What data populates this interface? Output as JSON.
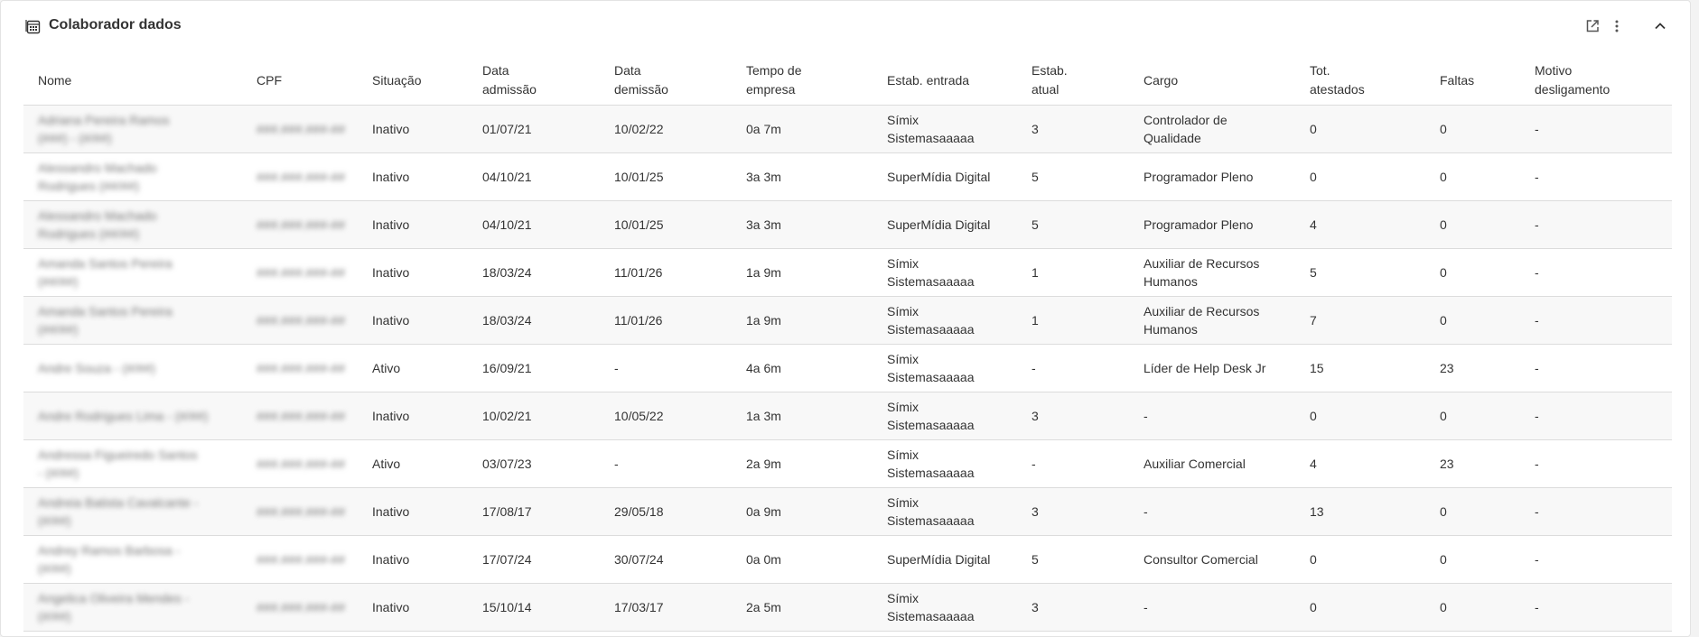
{
  "title": "Colaborador dados",
  "icons": {
    "title": "calculator-icon",
    "open": "open-external-icon",
    "more": "more-vertical-icon",
    "collapse": "chevron-up-icon"
  },
  "columns": [
    "Nome",
    "CPF",
    "Situação",
    "Data admissão",
    "Data demissão",
    "Tempo de empresa",
    "Estab. entrada",
    "Estab. atual",
    "Cargo",
    "Tot. atestados",
    "Faltas",
    "Motivo desligamento"
  ],
  "header_lines": [
    [
      "Nome"
    ],
    [
      "CPF"
    ],
    [
      "Situação"
    ],
    [
      "Data",
      "admissão"
    ],
    [
      "Data",
      "demissão"
    ],
    [
      "Tempo de",
      "empresa"
    ],
    [
      "Estab. entrada"
    ],
    [
      "Estab.",
      "atual"
    ],
    [
      "Cargo"
    ],
    [
      "Tot.",
      "atestados"
    ],
    [
      "Faltas"
    ],
    [
      "Motivo",
      "desligamento"
    ]
  ],
  "rows": [
    {
      "nome": [
        "Adriana Pereira Ramos",
        "(###) - (#/##)"
      ],
      "cpf": "###.###.###-##",
      "situacao": "Inativo",
      "admissao": "01/07/21",
      "demissao": "10/02/22",
      "tempo": "0a 7m",
      "estab_entrada": [
        "Símix",
        "Sistemasaaaaa"
      ],
      "estab_atual": "3",
      "cargo": [
        "Controlador de",
        "Qualidade"
      ],
      "atestados": "0",
      "faltas": "0",
      "motivo": "-"
    },
    {
      "nome": [
        "Alessandro Machado",
        "Rodrigues (##/##)"
      ],
      "cpf": "###.###.###-##",
      "situacao": "Inativo",
      "admissao": "04/10/21",
      "demissao": "10/01/25",
      "tempo": "3a 3m",
      "estab_entrada": [
        "SuperMídia Digital"
      ],
      "estab_atual": "5",
      "cargo": [
        "Programador Pleno"
      ],
      "atestados": "0",
      "faltas": "0",
      "motivo": "-"
    },
    {
      "nome": [
        "Alessandro Machado",
        "Rodrigues (##/##)"
      ],
      "cpf": "###.###.###-##",
      "situacao": "Inativo",
      "admissao": "04/10/21",
      "demissao": "10/01/25",
      "tempo": "3a 3m",
      "estab_entrada": [
        "SuperMídia Digital"
      ],
      "estab_atual": "5",
      "cargo": [
        "Programador Pleno"
      ],
      "atestados": "4",
      "faltas": "0",
      "motivo": "-"
    },
    {
      "nome": [
        "Amanda Santos Pereira",
        "(##/##)"
      ],
      "cpf": "###.###.###-##",
      "situacao": "Inativo",
      "admissao": "18/03/24",
      "demissao": "11/01/26",
      "tempo": "1a 9m",
      "estab_entrada": [
        "Símix",
        "Sistemasaaaaa"
      ],
      "estab_atual": "1",
      "cargo": [
        "Auxiliar de Recursos",
        "Humanos"
      ],
      "atestados": "5",
      "faltas": "0",
      "motivo": "-"
    },
    {
      "nome": [
        "Amanda Santos Pereira",
        "(##/##)"
      ],
      "cpf": "###.###.###-##",
      "situacao": "Inativo",
      "admissao": "18/03/24",
      "demissao": "11/01/26",
      "tempo": "1a 9m",
      "estab_entrada": [
        "Símix",
        "Sistemasaaaaa"
      ],
      "estab_atual": "1",
      "cargo": [
        "Auxiliar de Recursos",
        "Humanos"
      ],
      "atestados": "7",
      "faltas": "0",
      "motivo": "-"
    },
    {
      "nome": [
        "Andre Souza - (#/##)"
      ],
      "cpf": "###.###.###-##",
      "situacao": "Ativo",
      "admissao": "16/09/21",
      "demissao": "-",
      "tempo": "4a 6m",
      "estab_entrada": [
        "Símix",
        "Sistemasaaaaa"
      ],
      "estab_atual": "-",
      "cargo": [
        "Líder de Help Desk Jr"
      ],
      "atestados": "15",
      "faltas": "23",
      "motivo": "-"
    },
    {
      "nome": [
        "Andre Rodrigues Lima - (#/##)"
      ],
      "cpf": "###.###.###-##",
      "situacao": "Inativo",
      "admissao": "10/02/21",
      "demissao": "10/05/22",
      "tempo": "1a 3m",
      "estab_entrada": [
        "Símix",
        "Sistemasaaaaa"
      ],
      "estab_atual": "3",
      "cargo": [
        "-"
      ],
      "atestados": "0",
      "faltas": "0",
      "motivo": "-"
    },
    {
      "nome": [
        "Andressa Figueiredo Santos",
        "- (#/##)"
      ],
      "cpf": "###.###.###-##",
      "situacao": "Ativo",
      "admissao": "03/07/23",
      "demissao": "-",
      "tempo": "2a 9m",
      "estab_entrada": [
        "Símix",
        "Sistemasaaaaa"
      ],
      "estab_atual": "-",
      "cargo": [
        "Auxiliar Comercial"
      ],
      "atestados": "4",
      "faltas": "23",
      "motivo": "-"
    },
    {
      "nome": [
        "Andreia Batista Cavalcante -",
        "(#/##)"
      ],
      "cpf": "###.###.###-##",
      "situacao": "Inativo",
      "admissao": "17/08/17",
      "demissao": "29/05/18",
      "tempo": "0a 9m",
      "estab_entrada": [
        "Símix",
        "Sistemasaaaaa"
      ],
      "estab_atual": "3",
      "cargo": [
        "-"
      ],
      "atestados": "13",
      "faltas": "0",
      "motivo": "-"
    },
    {
      "nome": [
        "Andrey Ramos Barbosa -",
        "(#/##)"
      ],
      "cpf": "###.###.###-##",
      "situacao": "Inativo",
      "admissao": "17/07/24",
      "demissao": "30/07/24",
      "tempo": "0a 0m",
      "estab_entrada": [
        "SuperMídia Digital"
      ],
      "estab_atual": "5",
      "cargo": [
        "Consultor Comercial"
      ],
      "atestados": "0",
      "faltas": "0",
      "motivo": "-"
    },
    {
      "nome": [
        "Angelica Oliveira Mendes -",
        "(#/##)"
      ],
      "cpf": "###.###.###-##",
      "situacao": "Inativo",
      "admissao": "15/10/14",
      "demissao": "17/03/17",
      "tempo": "2a 5m",
      "estab_entrada": [
        "Símix",
        "Sistemasaaaaa"
      ],
      "estab_atual": "3",
      "cargo": [
        "-"
      ],
      "atestados": "0",
      "faltas": "0",
      "motivo": "-"
    }
  ]
}
